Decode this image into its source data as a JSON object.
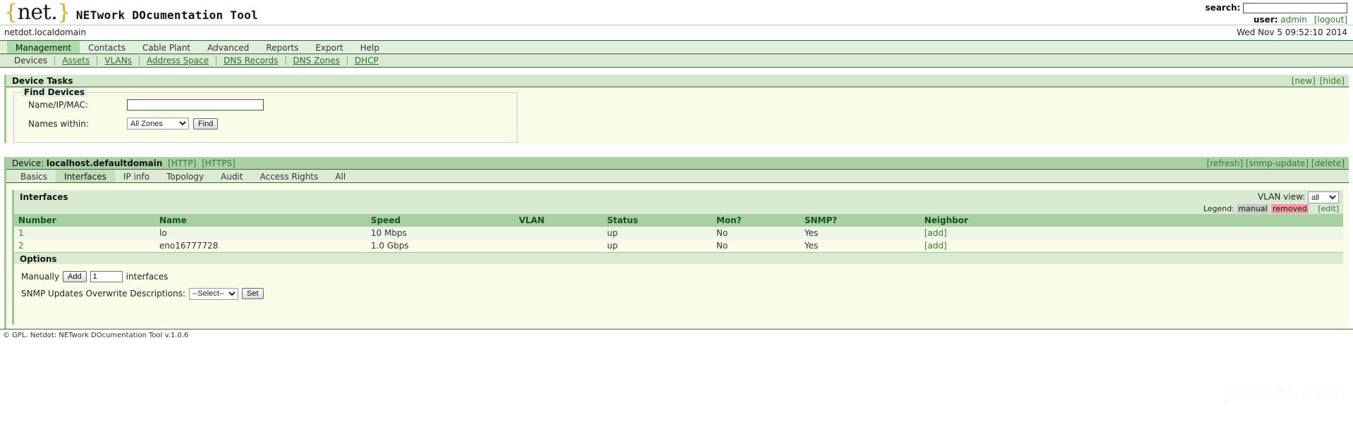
{
  "header": {
    "logo_brace_left": "{",
    "logo_word": "net",
    "logo_dot": ".",
    "logo_brace_right": "}",
    "tagline": "NETwork DOcumentation Tool",
    "hostname": "netdot.localdomain",
    "datetime": "Wed Nov 5 09:52:10 2014",
    "search_label": "search:",
    "search_value": "",
    "search_placeholder": "",
    "user_label": "user:",
    "user_value": "admin",
    "logout_label": "[logout]"
  },
  "nav": {
    "main": [
      {
        "label": "Management",
        "active": true
      },
      {
        "label": "Contacts",
        "active": false
      },
      {
        "label": "Cable Plant",
        "active": false
      },
      {
        "label": "Advanced",
        "active": false
      },
      {
        "label": "Reports",
        "active": false
      },
      {
        "label": "Export",
        "active": false
      },
      {
        "label": "Help",
        "active": false
      }
    ],
    "sub": [
      {
        "label": "Devices",
        "current": true
      },
      {
        "label": "Assets",
        "current": false
      },
      {
        "label": "VLANs",
        "current": false
      },
      {
        "label": "Address Space",
        "current": false
      },
      {
        "label": "DNS Records",
        "current": false
      },
      {
        "label": "DNS Zones",
        "current": false
      },
      {
        "label": "DHCP",
        "current": false
      }
    ]
  },
  "device_tasks": {
    "title": "Device Tasks",
    "new_label": "[new]",
    "hide_label": "[hide]",
    "find_devices_legend": "Find Devices",
    "name_ip_mac_label": "Name/IP/MAC:",
    "name_ip_mac_value": "",
    "names_within_label": "Names within:",
    "zone_selected": "All Zones",
    "zone_options": [
      "All Zones"
    ],
    "find_button": "Find"
  },
  "device": {
    "prefix": "Device:",
    "name": "localhost.defaultdomain",
    "http_label": "[HTTP]",
    "https_label": "[HTTPS]",
    "refresh_label": "[refresh]",
    "snmp_update_label": "[snmp-update]",
    "delete_label": "[delete]",
    "tabs": [
      {
        "label": "Basics",
        "active": false
      },
      {
        "label": "Interfaces",
        "active": true
      },
      {
        "label": "IP info",
        "active": false
      },
      {
        "label": "Topology",
        "active": false
      },
      {
        "label": "Audit",
        "active": false
      },
      {
        "label": "Access Rights",
        "active": false
      },
      {
        "label": "All",
        "active": false
      }
    ]
  },
  "interfaces": {
    "title": "Interfaces",
    "vlan_view_label": "VLAN view:",
    "vlan_view_selected": "all",
    "vlan_view_options": [
      "all"
    ],
    "legend_label": "Legend:",
    "legend_manual": "manual",
    "legend_removed": "removed",
    "legend_edit": "[edit]",
    "columns": [
      "Number",
      "Name",
      "Speed",
      "VLAN",
      "Status",
      "Mon?",
      "SNMP?",
      "Neighbor"
    ],
    "rows": [
      {
        "number": "1",
        "name": "lo",
        "speed": "10 Mbps",
        "vlan": "",
        "status": "up",
        "mon": "No",
        "snmp": "Yes",
        "neighbor": "[add]"
      },
      {
        "number": "2",
        "name": "eno16777728",
        "speed": "1.0 Gbps",
        "vlan": "",
        "status": "up",
        "mon": "No",
        "snmp": "Yes",
        "neighbor": "[add]"
      }
    ]
  },
  "options": {
    "title": "Options",
    "manually_label": "Manually",
    "add_button": "Add",
    "count_value": "1",
    "interfaces_label": "interfaces",
    "snmp_overwrite_label": "SNMP Updates Overwrite Descriptions:",
    "snmp_overwrite_selected": "--Select--",
    "snmp_overwrite_options": [
      "--Select--"
    ],
    "set_button": "Set"
  },
  "footer": {
    "text": "© GPL. Netdot: NETwork DOcumentation Tool v.1.0.6"
  },
  "watermark": {
    "text": "yousei.com"
  },
  "colors": {
    "accent_green": "#2e7d32",
    "header_green": "#a8cfa1",
    "panel_cream": "#fbfbe9",
    "legend_manual_bg": "#c9c9c9",
    "legend_removed_bg": "#f59aa0"
  }
}
